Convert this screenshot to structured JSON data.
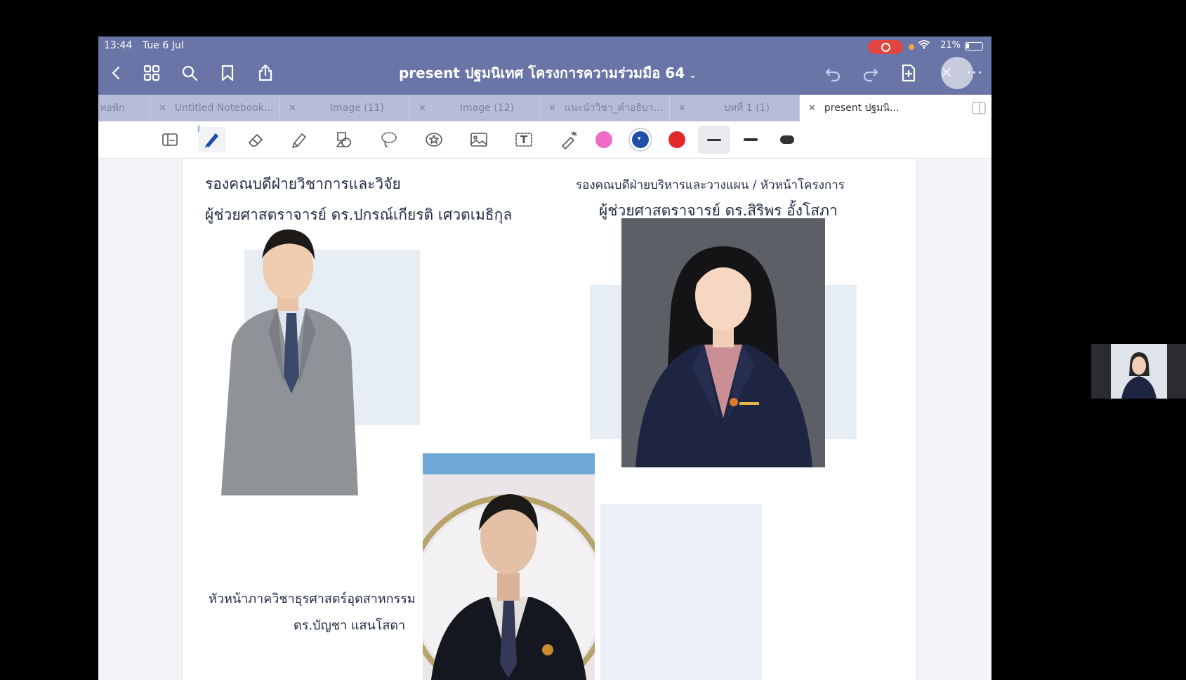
{
  "status_bar": {
    "time": "13:44",
    "date": "Tue 6 Jul",
    "battery": "21%"
  },
  "nav": {
    "title": "present ปฐมนิเทศ โครงการความร่วมมือ 64",
    "title_chevron": "⌄",
    "close_glyph": "✕",
    "more_glyph": "···"
  },
  "tabs": [
    {
      "label": "หอพัก",
      "close": ""
    },
    {
      "label": "Untitled Notebook...",
      "close": "✕"
    },
    {
      "label": "Image (11)",
      "close": "✕"
    },
    {
      "label": "Image (12)",
      "close": "✕"
    },
    {
      "label": "แนะนำวิชา_คำอธิบา...",
      "close": "✕"
    },
    {
      "label": "บทที่ 1 (1)",
      "close": "✕"
    },
    {
      "label": "present ปฐมนิ...",
      "close": "✕"
    }
  ],
  "toolbar": {
    "text_tool_glyph": "T",
    "colors": [
      "#f06ac8",
      "#1f4fa8",
      "#e22a2a"
    ]
  },
  "page": {
    "left_role": "รองคณบดีฝ่ายวิชาการและวิจัย",
    "left_name": "ผู้ช่วยศาสตราจารย์ ดร.ปกรณ์เกียรติ เศวตเมธิกุล",
    "right_role": "รองคณบดีฝ่ายบริหารและวางแผน / หัวหน้าโครงการ",
    "right_name": "ผู้ช่วยศาสตราจารย์ ดร.สิริพร อั้งโสภา",
    "bottom_role": "หัวหน้าภาควิชาธุรศาสตร์อุตสาหกรรม",
    "bottom_name": "ดร.บัญชา แสนโสดา"
  }
}
